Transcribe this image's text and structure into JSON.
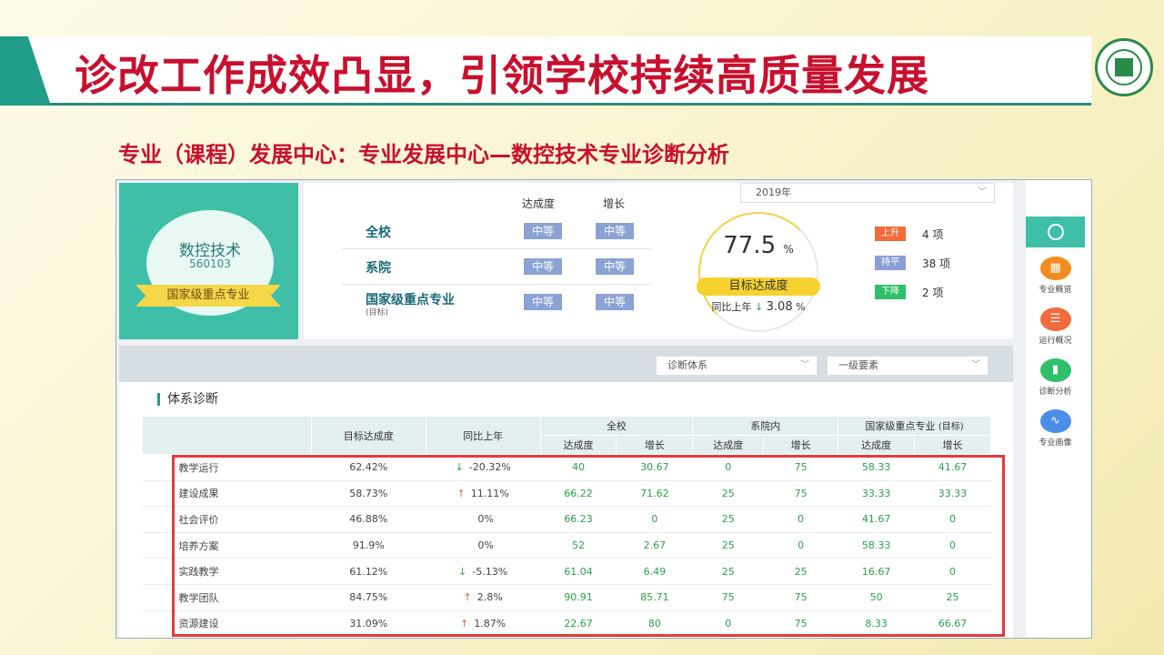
{
  "slide": {
    "title": "诊改工作成效凸显，引领学校持续高质量发展",
    "subtitle": "专业（课程）发展中心：专业发展中心—数控技术专业诊断分析"
  },
  "major": {
    "name": "数控技术",
    "code": "560103",
    "ribbon": "国家级重点专业"
  },
  "summary": {
    "columns": [
      "达成度",
      "增长"
    ],
    "rows": [
      {
        "label": "全校",
        "sub": "",
        "achievement": "中等",
        "growth": "中等"
      },
      {
        "label": "系院",
        "sub": "",
        "achievement": "中等",
        "growth": "中等"
      },
      {
        "label": "国家级重点专业",
        "sub": "(目标)",
        "achievement": "中等",
        "growth": "中等"
      }
    ]
  },
  "year_select": {
    "value": "2019年"
  },
  "gauge": {
    "value": "77.5",
    "unit": "%",
    "label": "目标达成度",
    "yoy_prefix": "同比上年",
    "yoy_arrow": "↓",
    "yoy_value": "3.08",
    "yoy_unit": "%"
  },
  "trends": [
    {
      "tag": "上升",
      "count": "4 项",
      "color": "#f26b3a"
    },
    {
      "tag": "持平",
      "count": "38 项",
      "color": "#8a9fd8"
    },
    {
      "tag": "下降",
      "count": "2 项",
      "color": "#2fbf6a"
    }
  ],
  "rail": [
    {
      "label": "专业概览",
      "icon": "grid-icon",
      "glyph": "▦",
      "color": "#f28c1e"
    },
    {
      "label": "运行概况",
      "icon": "list-icon",
      "glyph": "☰",
      "color": "#f26b3a"
    },
    {
      "label": "诊断分析",
      "icon": "bar-chart-icon",
      "glyph": "▮",
      "color": "#2fbf6a"
    },
    {
      "label": "专业画像",
      "icon": "trend-icon",
      "glyph": "∿",
      "color": "#4a8ee8"
    }
  ],
  "filters": {
    "system": "诊断体系",
    "element": "一级要素"
  },
  "section_title": "体系诊断",
  "table": {
    "headers": {
      "target": "目标达成度",
      "yoy": "同比上年",
      "school": "全校",
      "dept": "系院内",
      "national": "国家级重点专业",
      "national_sub": "(目标)",
      "achievement": "达成度",
      "growth": "增长"
    },
    "rows": [
      {
        "name": "教学运行",
        "target": "62.42%",
        "yoy_dir": "↓",
        "yoy": "-20.32%",
        "s_a": "40",
        "s_g": "30.67",
        "d_a": "0",
        "d_g": "75",
        "n_a": "58.33",
        "n_g": "41.67"
      },
      {
        "name": "建设成果",
        "target": "58.73%",
        "yoy_dir": "↑",
        "yoy": "11.11%",
        "s_a": "66.22",
        "s_g": "71.62",
        "d_a": "25",
        "d_g": "75",
        "n_a": "33.33",
        "n_g": "33.33"
      },
      {
        "name": "社会评价",
        "target": "46.88%",
        "yoy_dir": "",
        "yoy": "0%",
        "s_a": "66.23",
        "s_g": "0",
        "d_a": "25",
        "d_g": "0",
        "n_a": "41.67",
        "n_g": "0"
      },
      {
        "name": "培养方案",
        "target": "91.9%",
        "yoy_dir": "",
        "yoy": "0%",
        "s_a": "52",
        "s_g": "2.67",
        "d_a": "25",
        "d_g": "0",
        "n_a": "58.33",
        "n_g": "0"
      },
      {
        "name": "实践教学",
        "target": "61.12%",
        "yoy_dir": "↓",
        "yoy": "-5.13%",
        "s_a": "61.04",
        "s_g": "6.49",
        "d_a": "25",
        "d_g": "25",
        "n_a": "16.67",
        "n_g": "0"
      },
      {
        "name": "教学团队",
        "target": "84.75%",
        "yoy_dir": "↑",
        "yoy": "2.8%",
        "s_a": "90.91",
        "s_g": "85.71",
        "d_a": "75",
        "d_g": "75",
        "n_a": "50",
        "n_g": "25"
      },
      {
        "name": "资源建设",
        "target": "31.09%",
        "yoy_dir": "↑",
        "yoy": "1.87%",
        "s_a": "22.67",
        "s_g": "80",
        "d_a": "0",
        "d_g": "75",
        "n_a": "8.33",
        "n_g": "66.67"
      }
    ]
  }
}
